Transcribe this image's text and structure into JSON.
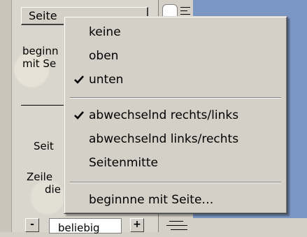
{
  "background_dialog": {
    "page_button_label": "Seite",
    "label_line1": "beginn",
    "label_line2": "mit Se",
    "label_page": "Seit",
    "label_lines1": "Zeile",
    "label_lines2": "die",
    "minus_label": "-",
    "plus_label": "+",
    "input_value": "beliebig"
  },
  "menu": {
    "items": [
      {
        "label": "keine",
        "checked": false
      },
      {
        "label": "oben",
        "checked": false
      },
      {
        "label": "unten",
        "checked": true
      },
      {
        "label": "abwechselnd rechts/links",
        "checked": true
      },
      {
        "label": "abwechselnd links/rechts",
        "checked": false
      },
      {
        "label": "Seitenmitte",
        "checked": false
      },
      {
        "label": "beginnne mit Seite…",
        "checked": false
      }
    ]
  },
  "colors": {
    "menu_bg": "#d4d0c8",
    "desktop_blue": "#7a96c3"
  }
}
